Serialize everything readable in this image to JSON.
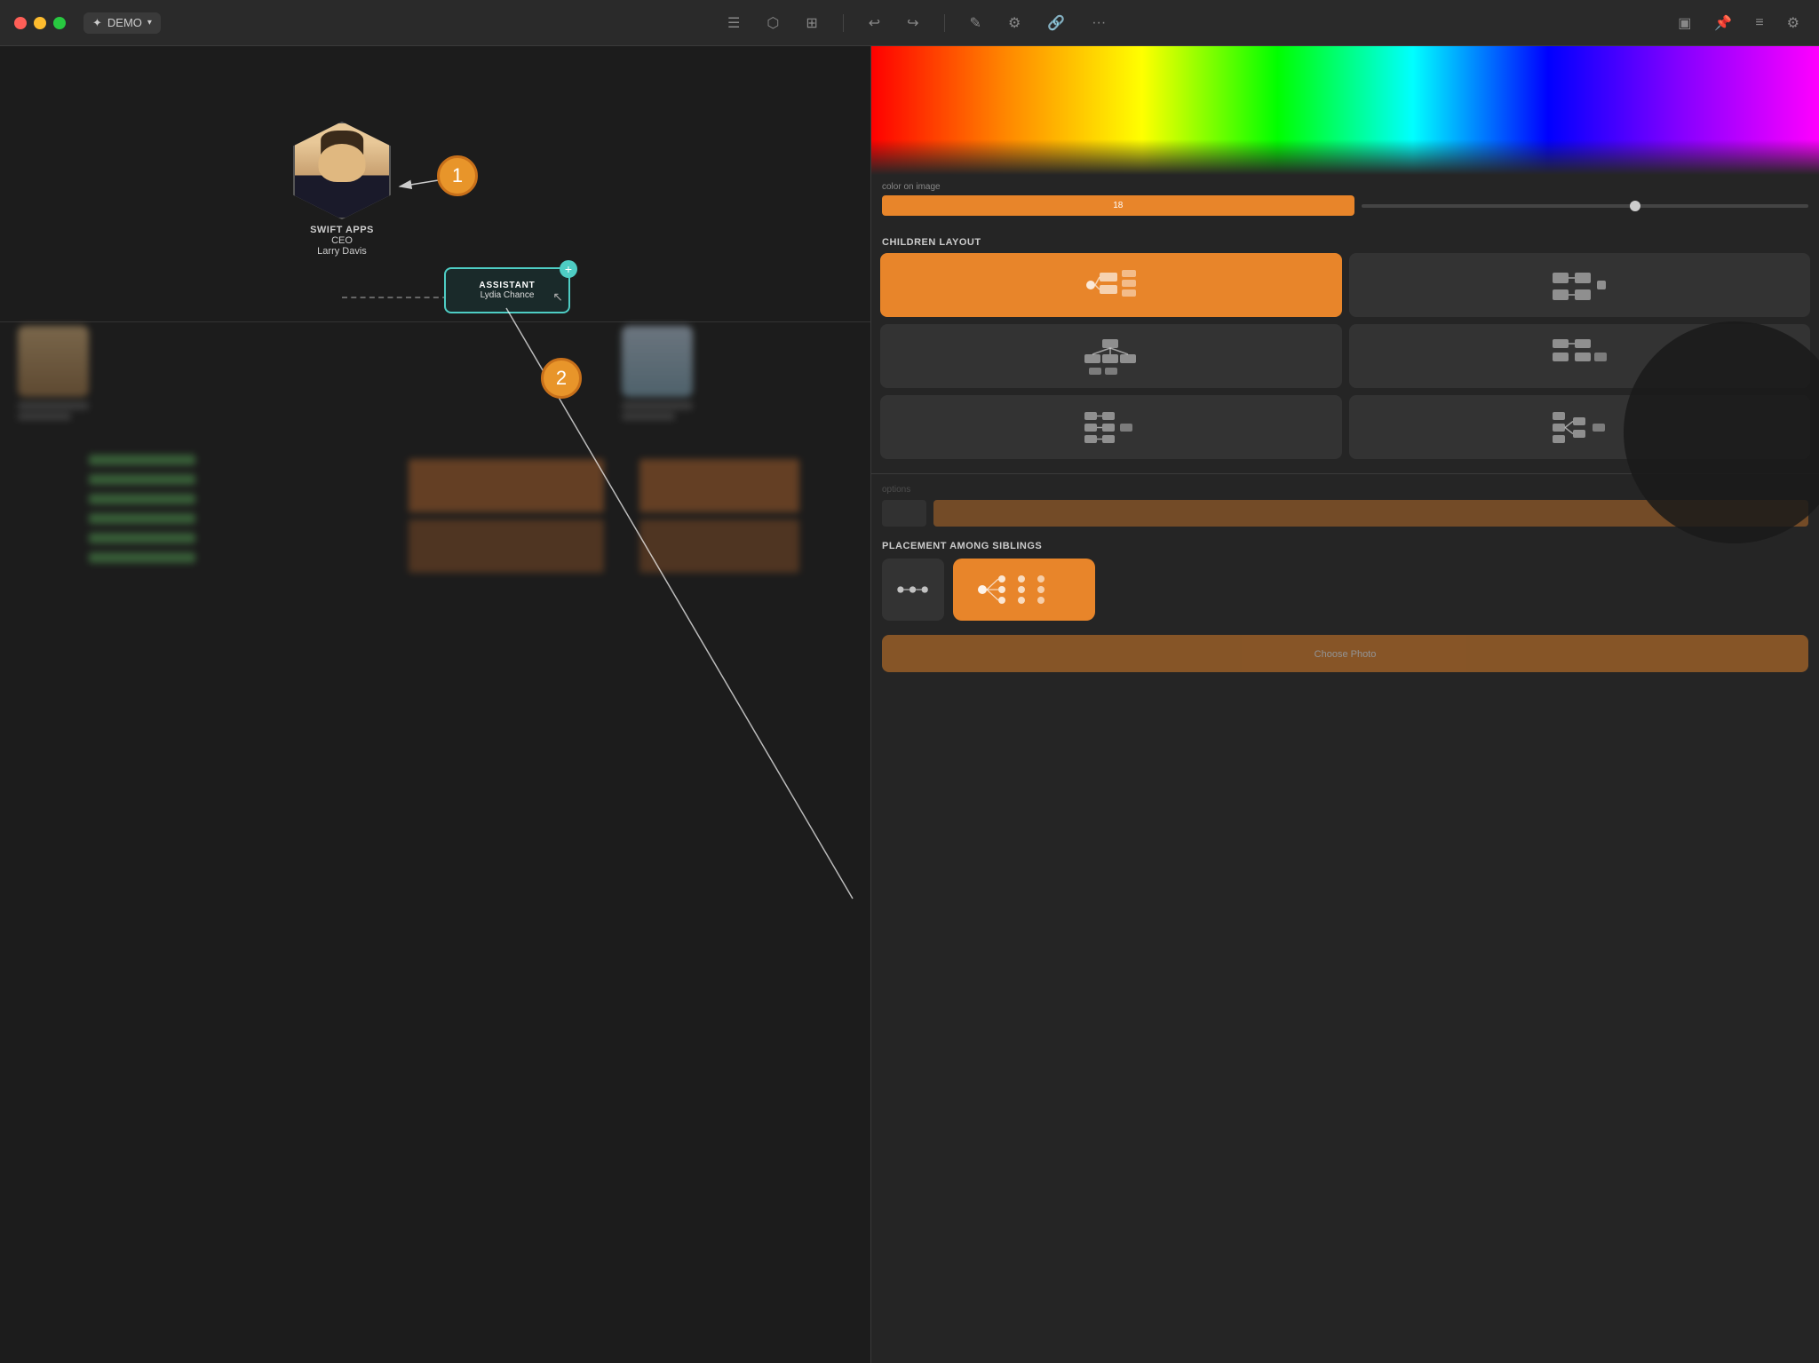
{
  "titlebar": {
    "traffic_lights": [
      "red",
      "yellow",
      "green"
    ],
    "demo_label": "DEMO",
    "icons": {
      "list": "☰",
      "hierarchy": "⬡",
      "columns": "⊞",
      "undo": "↩",
      "redo": "↪",
      "edit": "✎",
      "sliders": "⚙",
      "link": "🔗",
      "more": "···",
      "sidebar": "▣",
      "pin": "📌",
      "list2": "≡",
      "settings": "⚙"
    }
  },
  "canvas": {
    "ceo_node": {
      "company": "SWIFT APPS",
      "title": "CEO",
      "name": "Larry Davis"
    },
    "assistant_node": {
      "label": "ASSISTANT",
      "name": "Lydia Chance"
    },
    "step_badges": [
      "1",
      "2"
    ]
  },
  "right_panel": {
    "color_spectrum": true,
    "orange_btn_label": "18",
    "children_layout_title": "CHILDREN LAYOUT",
    "placement_title": "PLACEMENT AMONG SIBLINGS",
    "layout_options": [
      {
        "id": "layout-1",
        "active": true
      },
      {
        "id": "layout-2",
        "active": false
      },
      {
        "id": "layout-3",
        "active": false
      },
      {
        "id": "layout-4",
        "active": false
      },
      {
        "id": "layout-5",
        "active": false
      },
      {
        "id": "layout-6",
        "active": false
      }
    ],
    "placement_options": [
      {
        "id": "placement-1",
        "active": false
      },
      {
        "id": "placement-2",
        "active": true
      }
    ]
  }
}
